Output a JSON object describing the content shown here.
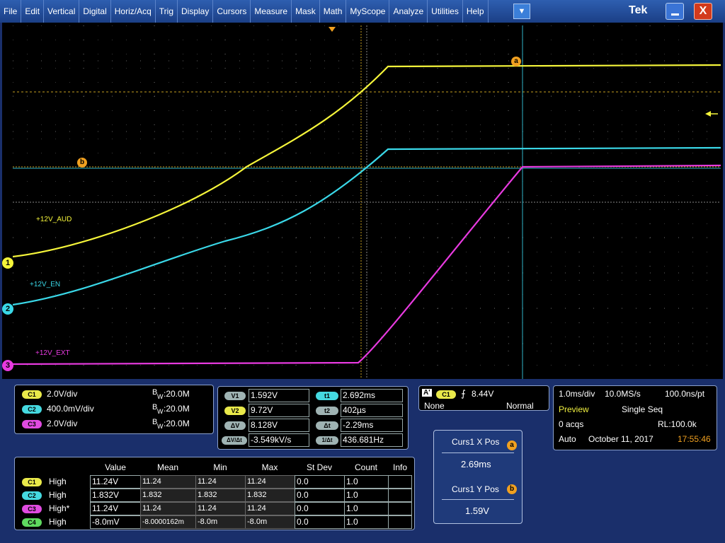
{
  "menu": [
    "File",
    "Edit",
    "Vertical",
    "Digital",
    "Horiz/Acq",
    "Trig",
    "Display",
    "Cursors",
    "Measure",
    "Mask",
    "Math",
    "MyScope",
    "Analyze",
    "Utilities",
    "Help"
  ],
  "window": {
    "brand": "Tek",
    "dropdown": "▼",
    "close": "X"
  },
  "traces": {
    "ch1": {
      "label": "+12V_AUD",
      "marker": "1",
      "color": "#f5f53a"
    },
    "ch2": {
      "label": "+12V_EN",
      "marker": "2",
      "color": "#3ad8e8"
    },
    "ch3": {
      "label": "+12V_EXT",
      "marker": "3",
      "color": "#e83ae0"
    },
    "cursor_a": "a",
    "cursor_b": "b"
  },
  "channels": [
    {
      "badge": "C1",
      "scale": "2.0V/div",
      "bw_label": "B",
      "bw_sub": "W",
      "bw": ":20.0M"
    },
    {
      "badge": "C2",
      "scale": "400.0mV/div",
      "bw_label": "B",
      "bw_sub": "W",
      "bw": ":20.0M"
    },
    {
      "badge": "C3",
      "scale": "2.0V/div",
      "bw_label": "B",
      "bw_sub": "W",
      "bw": ":20.0M"
    }
  ],
  "cursors": {
    "v1_label": "V1",
    "v1": "1.592V",
    "v2_label": "V2",
    "v2": "9.72V",
    "dv_label": "ΔV",
    "dv": "8.128V",
    "dvdt_label": "ΔV/Δt",
    "dvdt": "-3.549kV/s",
    "t1_label": "t1",
    "t1": "2.692ms",
    "t2_label": "t2",
    "t2": "402µs",
    "dt_label": "Δt",
    "dt": "-2.29ms",
    "inv_label": "1/Δt",
    "inv": "436.681Hz"
  },
  "trigger": {
    "type": "A'",
    "source": "C1",
    "slope": "⨍",
    "level": "8.44V",
    "coupling": "None",
    "mode": "Normal"
  },
  "acquisition": {
    "timebase": "1.0ms/div",
    "sample_rate": "10.0MS/s",
    "resolution": "100.0ns/pt",
    "state": "Preview",
    "run_mode": "Single Seq",
    "acqs": "0 acqs",
    "record_length": "RL:100.0k",
    "trigger_mode": "Auto",
    "date": "October 11, 2017",
    "time": "17:55:46"
  },
  "curs_readout": {
    "x_title": "Curs1 X Pos",
    "x_marker": "a",
    "x_value": "2.69ms",
    "y_title": "Curs1 Y Pos",
    "y_marker": "b",
    "y_value": "1.59V"
  },
  "measurements": {
    "headers": [
      "Value",
      "Mean",
      "Min",
      "Max",
      "St Dev",
      "Count",
      "Info"
    ],
    "rows": [
      {
        "badge": "C1",
        "name": "High",
        "value": "11.24V",
        "mean": "11.24",
        "min": "11.24",
        "max": "11.24",
        "stdev": "0.0",
        "count": "1.0",
        "info": ""
      },
      {
        "badge": "C2",
        "name": "High",
        "value": "1.832V",
        "mean": "1.832",
        "min": "1.832",
        "max": "1.832",
        "stdev": "0.0",
        "count": "1.0",
        "info": ""
      },
      {
        "badge": "C3",
        "name": "High*",
        "value": "11.24V",
        "mean": "11.24",
        "min": "11.24",
        "max": "11.24",
        "stdev": "0.0",
        "count": "1.0",
        "info": ""
      },
      {
        "badge": "C4",
        "name": "High",
        "value": "-8.0mV",
        "mean": "-8.0000162m",
        "min": "-8.0m",
        "max": "-8.0m",
        "stdev": "0.0",
        "count": "1.0",
        "info": ""
      }
    ]
  }
}
